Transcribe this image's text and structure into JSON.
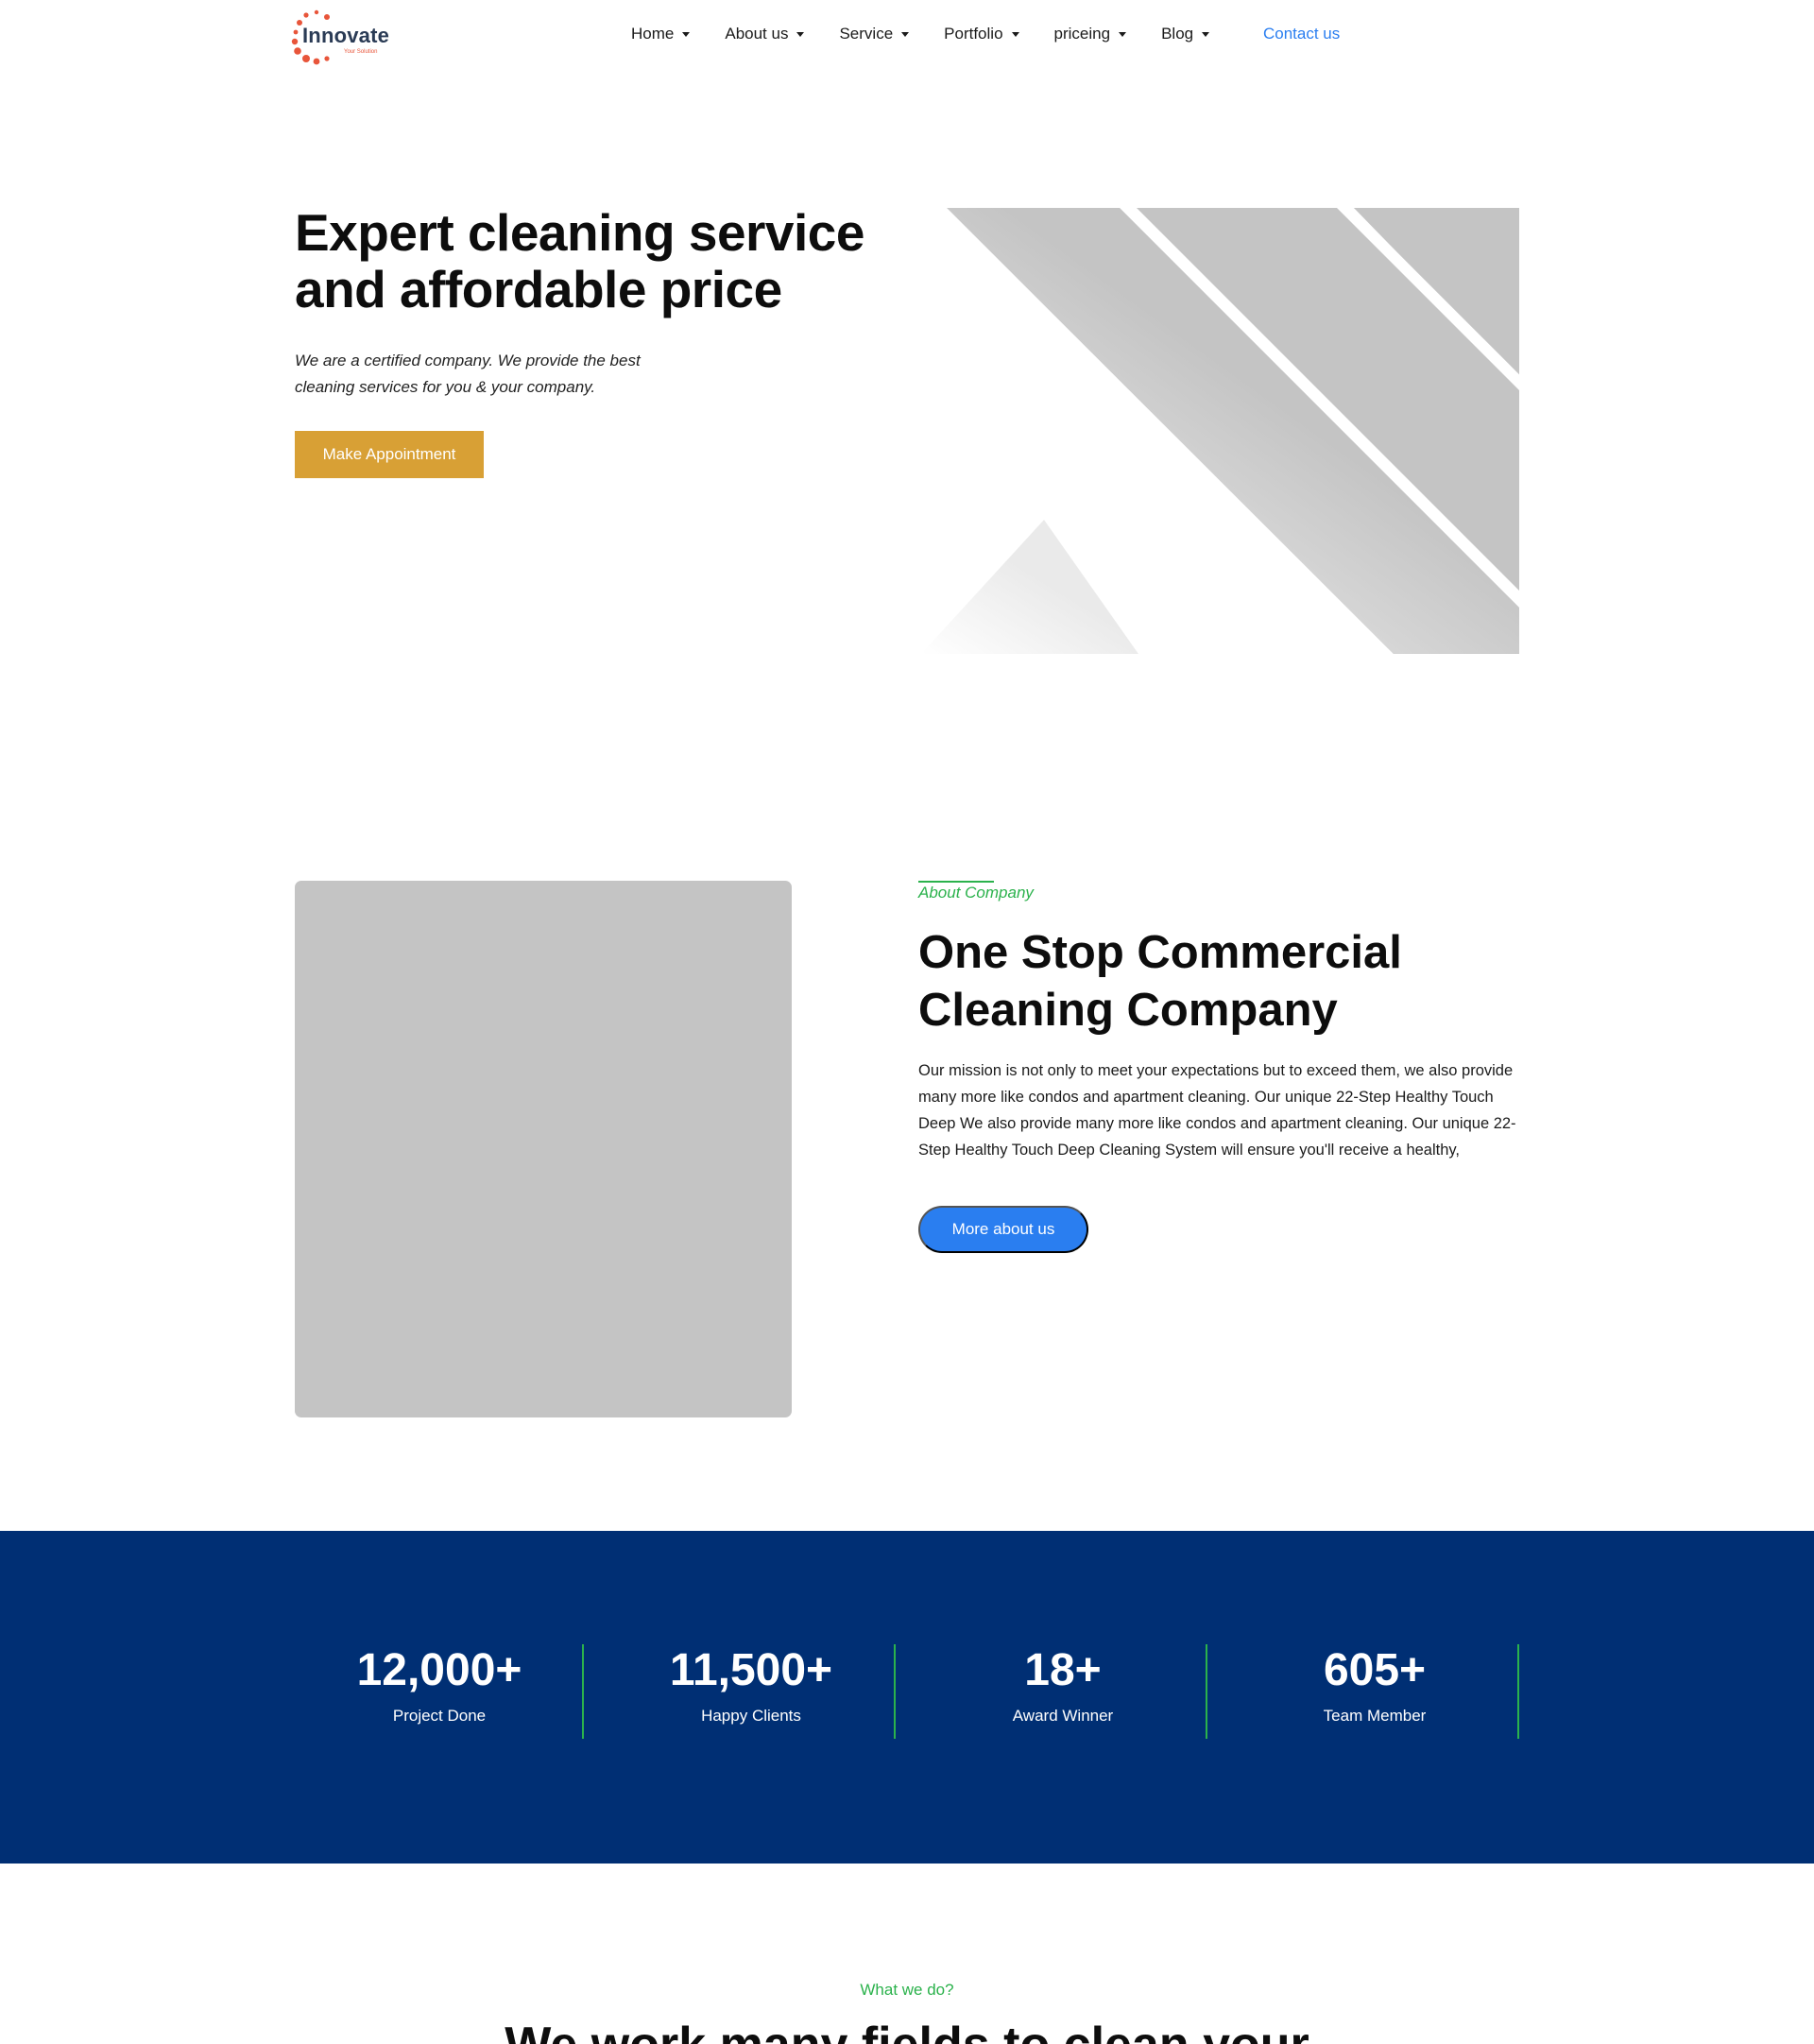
{
  "brand": {
    "name": "Innovate",
    "tagline": "Your Solution",
    "accent": "#e8553a"
  },
  "nav": {
    "items": [
      {
        "label": "Home",
        "icon": "chevron-down-icon"
      },
      {
        "label": "About us",
        "icon": "chevron-down-icon"
      },
      {
        "label": "Service",
        "icon": "chevron-down-icon"
      },
      {
        "label": "Portfolio",
        "icon": "chevron-down-icon"
      },
      {
        "label": "priceing",
        "icon": "chevron-down-icon"
      },
      {
        "label": "Blog",
        "icon": "chevron-down-icon"
      }
    ],
    "contact_label": "Contact us"
  },
  "hero": {
    "title": "Expert cleaning service and affordable price",
    "subtitle": "We are a certified company. We provide the best cleaning services for you & your company.",
    "cta_label": "Make Appointment"
  },
  "about": {
    "tag": "About Company",
    "title": "One Stop Commercial Cleaning Company",
    "body": "Our mission is not only to meet your expectations but to exceed them, we also provide many more like condos and apartment cleaning. Our unique 22-Step Healthy Touch Deep We also provide many more like condos and apartment cleaning. Our unique 22-Step Healthy Touch Deep Cleaning System will ensure you'll receive a healthy,",
    "cta_label": "More about us"
  },
  "stats": [
    {
      "value": "12,000+",
      "label": "Project Done"
    },
    {
      "value": "11,500+",
      "label": "Happy Clients"
    },
    {
      "value": "18+",
      "label": "Award Winner"
    },
    {
      "value": "605+",
      "label": "Team Member"
    }
  ],
  "services": {
    "tag": "What we do?",
    "title": "We work many fields to clean your"
  },
  "colors": {
    "gold": "#d8a035",
    "primary_blue": "#2a7ef0",
    "navy": "#002f74",
    "green": "#2bb24c",
    "placeholder_gray": "#c4c4c4"
  }
}
